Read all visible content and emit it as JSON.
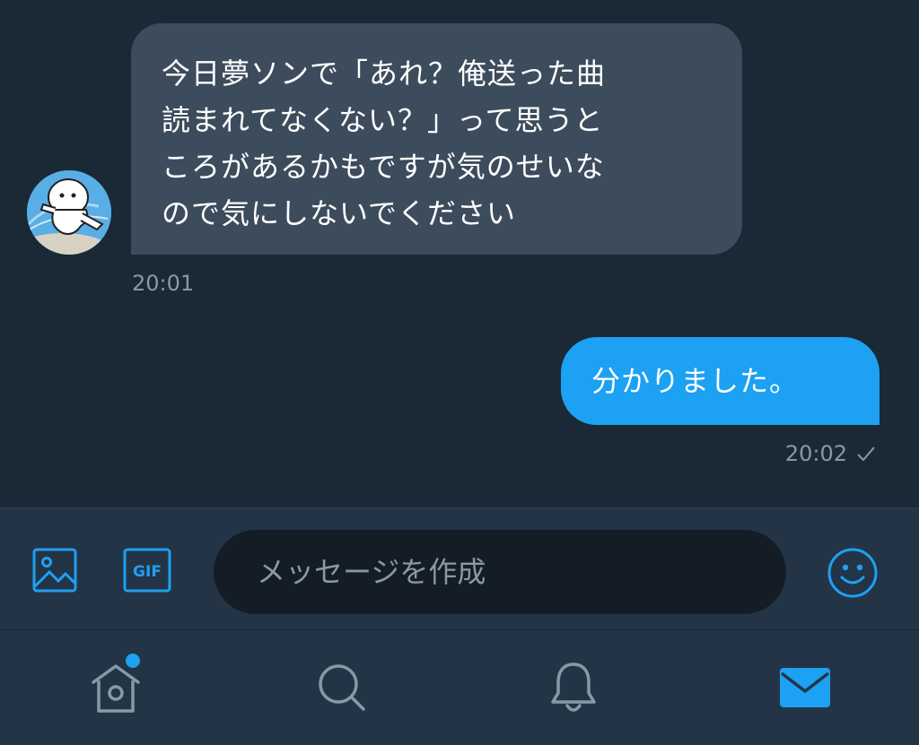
{
  "conversation": {
    "incoming": {
      "text": "今日夢ソンで「あれ？俺送った曲\n読まれてなくない？」って思うと\nころがあるかもですが気のせいな\nので気にしないでください",
      "time": "20:01"
    },
    "outgoing": {
      "text": "分かりました。",
      "time": "20:02"
    }
  },
  "composer": {
    "placeholder": "メッセージを作成",
    "gif_label": "GIF"
  },
  "icons": {
    "image": "image-icon",
    "gif": "gif-icon",
    "emoji": "emoji-icon",
    "home": "home-icon",
    "search": "search-icon",
    "notifications": "bell-icon",
    "messages": "mail-icon",
    "read": "checkmark-icon"
  },
  "colors": {
    "background": "#1b2836",
    "incoming_bubble": "#3c4c5c",
    "outgoing_bubble": "#1da1f2",
    "accent": "#1da1f2",
    "muted_text": "#8899a6",
    "bar_background": "#243447",
    "input_background": "#141d26"
  },
  "tabbar": {
    "active_tab": "messages",
    "home_has_notification": true
  }
}
